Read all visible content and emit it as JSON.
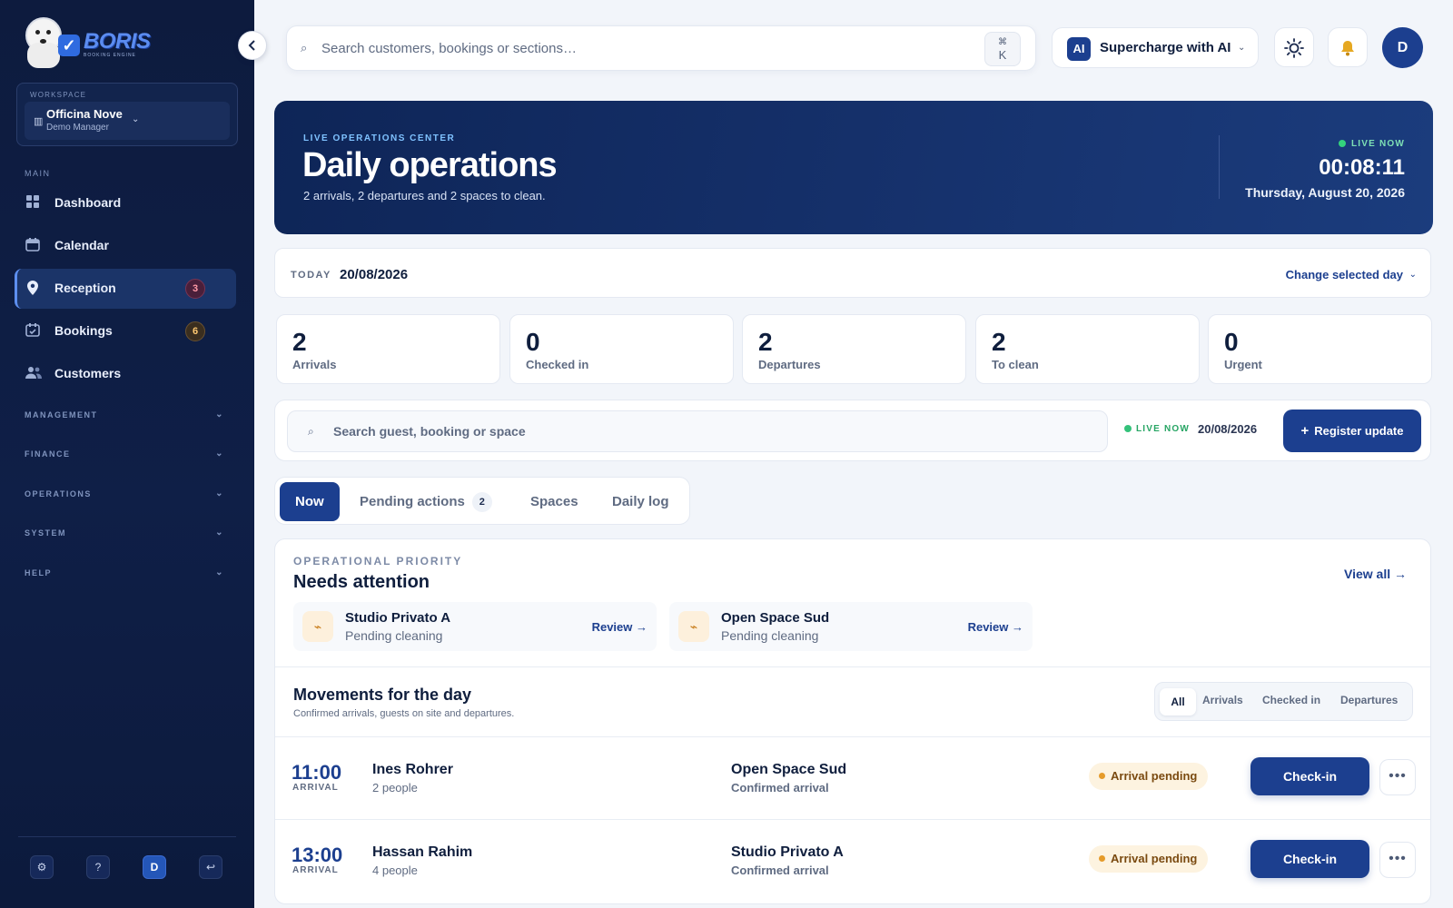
{
  "sidebar": {
    "logo": {
      "word": "BORIS",
      "sub": "BOOKING ENGINE"
    },
    "workspace": {
      "label": "WORKSPACE",
      "name": "Officina Nove",
      "role": "Demo Manager"
    },
    "section_main": "MAIN",
    "items": [
      {
        "label": "Dashboard",
        "icon": "grid-icon"
      },
      {
        "label": "Calendar",
        "icon": "calendar-icon"
      },
      {
        "label": "Reception",
        "icon": "location-pin-icon",
        "badge": "3",
        "active": true
      },
      {
        "label": "Bookings",
        "icon": "calendar-check-icon",
        "badge": "6"
      },
      {
        "label": "Customers",
        "icon": "users-icon"
      }
    ],
    "groups": [
      "MANAGEMENT",
      "FINANCE",
      "OPERATIONS",
      "SYSTEM",
      "HELP"
    ],
    "footer": {
      "settings": "⚙",
      "help": "?",
      "avatar": "D",
      "logout": "↩"
    }
  },
  "topbar": {
    "search_placeholder": "Search customers, bookings or sections…",
    "kbd_mod": "⌘",
    "kbd_key": "K",
    "ai_badge": "AI",
    "ai_label": "Supercharge with AI",
    "avatar": "D"
  },
  "hero": {
    "kicker": "LIVE OPERATIONS CENTER",
    "title": "Daily operations",
    "subtitle": "2 arrivals, 2 departures and 2 spaces to clean.",
    "live": "LIVE NOW",
    "time": "00:08:11",
    "date": "Thursday, August 20, 2026"
  },
  "today": {
    "label": "TODAY",
    "value": "20/08/2026",
    "change_label": "Change selected day"
  },
  "stats": [
    {
      "value": "2",
      "label": "Arrivals"
    },
    {
      "value": "0",
      "label": "Checked in"
    },
    {
      "value": "2",
      "label": "Departures"
    },
    {
      "value": "2",
      "label": "To clean"
    },
    {
      "value": "0",
      "label": "Urgent"
    }
  ],
  "search_row": {
    "placeholder": "Search guest, booking or space",
    "live": "LIVE NOW",
    "date": "20/08/2026",
    "register_label": "Register update"
  },
  "tabs": [
    {
      "label": "Now",
      "active": true
    },
    {
      "label": "Pending actions",
      "count": "2"
    },
    {
      "label": "Spaces"
    },
    {
      "label": "Daily log"
    }
  ],
  "attention": {
    "kicker": "OPERATIONAL PRIORITY",
    "title": "Needs attention",
    "view_all": "View all →",
    "cards": [
      {
        "name": "Studio Privato A",
        "status": "Pending cleaning",
        "action": "Review →"
      },
      {
        "name": "Open Space Sud",
        "status": "Pending cleaning",
        "action": "Review →"
      }
    ]
  },
  "movements": {
    "title": "Movements for the day",
    "subtitle": "Confirmed arrivals, guests on site and departures.",
    "filters": [
      "All",
      "Arrivals",
      "Checked in",
      "Departures"
    ],
    "rows": [
      {
        "time": "11:00",
        "kind": "ARRIVAL",
        "guest": "Ines Rohrer",
        "people": "2 people",
        "space": "Open Space Sud",
        "space_status": "Confirmed arrival",
        "badge": "Arrival pending",
        "action": "Check-in"
      },
      {
        "time": "13:00",
        "kind": "ARRIVAL",
        "guest": "Hassan Rahim",
        "people": "4 people",
        "space": "Studio Privato A",
        "space_status": "Confirmed arrival",
        "badge": "Arrival pending",
        "action": "Check-in"
      }
    ]
  },
  "colors": {
    "sidebar_bg": "#0d1b3e",
    "accent": "#1c3f8f",
    "live_green": "#34d27c",
    "warning": "#e59b2a"
  }
}
